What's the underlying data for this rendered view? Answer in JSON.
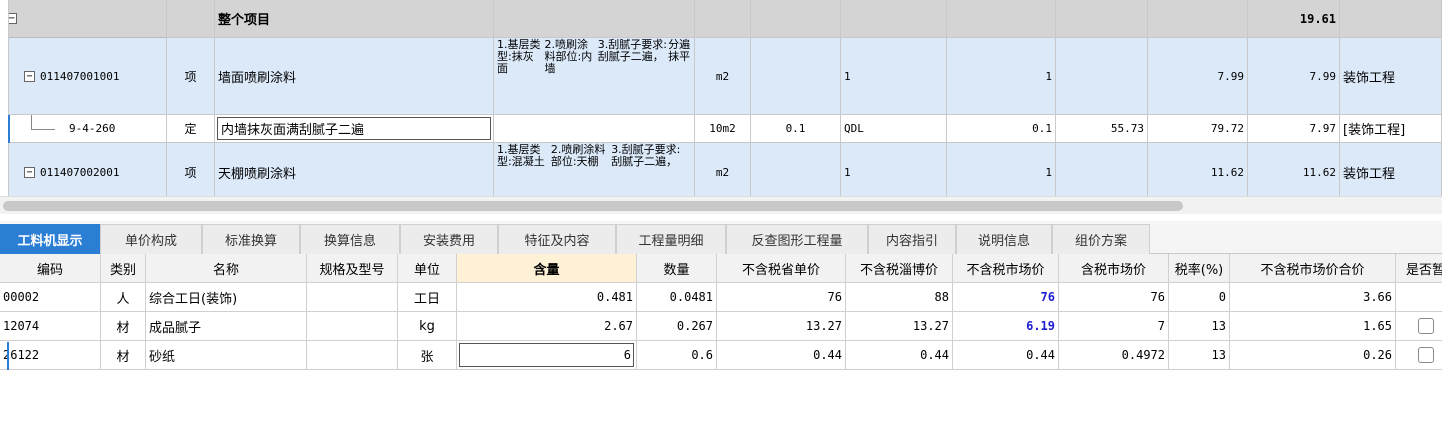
{
  "top_grid": {
    "rows": [
      {
        "type": "group",
        "expander": "−",
        "name": "整个项目",
        "total": "19.61"
      },
      {
        "type": "item",
        "expander": "−",
        "code": "011407001001",
        "category": "项",
        "name": "墙面喷刷涂料",
        "features": [
          "1.基层类型:抹灰面",
          "2.喷刷涂料部位:内墙",
          "3.刮腻子要求:刮腻子二遍，",
          "分遍抹平"
        ],
        "unit": "m2",
        "content": "",
        "expr": "1",
        "qty": "1",
        "price": "",
        "unit_price": "7.99",
        "total": "7.99",
        "major": "装饰工程"
      },
      {
        "type": "quota",
        "code": "9-4-260",
        "category": "定",
        "name": "内墙抹灰面满刮腻子二遍",
        "features": [],
        "unit": "10m2",
        "content": "0.1",
        "expr": "QDL",
        "qty": "0.1",
        "price": "55.73",
        "unit_price": "79.72",
        "total": "7.97",
        "major": "[装饰工程]"
      },
      {
        "type": "item",
        "expander": "−",
        "code": "011407002001",
        "category": "项",
        "name": "天棚喷刷涂料",
        "features": [
          "1.基层类型:混凝土",
          "2.喷刷涂料部位:天棚",
          "3.刮腻子要求:刮腻子二遍，"
        ],
        "unit": "m2",
        "content": "",
        "expr": "1",
        "qty": "1",
        "price": "",
        "unit_price": "11.62",
        "total": "11.62",
        "major": "装饰工程"
      }
    ]
  },
  "tabs": [
    {
      "label": "工料机显示",
      "active": true
    },
    {
      "label": "单价构成"
    },
    {
      "label": "标准换算"
    },
    {
      "label": "换算信息"
    },
    {
      "label": "安装费用"
    },
    {
      "label": "特征及内容"
    },
    {
      "label": "工程量明细"
    },
    {
      "label": "反查图形工程量"
    },
    {
      "label": "内容指引"
    },
    {
      "label": "说明信息"
    },
    {
      "label": "组价方案"
    }
  ],
  "bottom_grid": {
    "headers": [
      "编码",
      "类别",
      "名称",
      "规格及型号",
      "单位",
      "含量",
      "数量",
      "不含税省单价",
      "不含税淄博价",
      "不含税市场价",
      "含税市场价",
      "税率(%)",
      "不含税市场价合价",
      "是否暂"
    ],
    "rows": [
      {
        "code": "00002",
        "category": "人",
        "name": "综合工日(装饰)",
        "spec": "",
        "unit": "工日",
        "content": "0.481",
        "qty": "0.0481",
        "prov_price": "76",
        "zibo_price": "88",
        "market_price": "76",
        "tax_price": "76",
        "tax_rate": "0",
        "total": "3.66",
        "temp": false
      },
      {
        "code": "12074",
        "category": "材",
        "name": "成品腻子",
        "spec": "",
        "unit": "kg",
        "content": "2.67",
        "qty": "0.267",
        "prov_price": "13.27",
        "zibo_price": "13.27",
        "market_price": "6.19",
        "tax_price": "7",
        "tax_rate": "13",
        "total": "1.65",
        "temp": true
      },
      {
        "code": "26122",
        "category": "材",
        "name": "砂纸",
        "spec": "",
        "unit": "张",
        "content": "6",
        "qty": "0.6",
        "prov_price": "0.44",
        "zibo_price": "0.44",
        "market_price": "0.44",
        "tax_price": "0.4972",
        "tax_rate": "13",
        "total": "0.26",
        "temp": true
      }
    ]
  },
  "colors": {
    "group_row": "#d4d4d4",
    "item_row": "#dbe9f9",
    "accent_tab": "#2a7fd4",
    "highlight_value": "#1f1fd4",
    "header_highlight": "#fff1d6"
  }
}
